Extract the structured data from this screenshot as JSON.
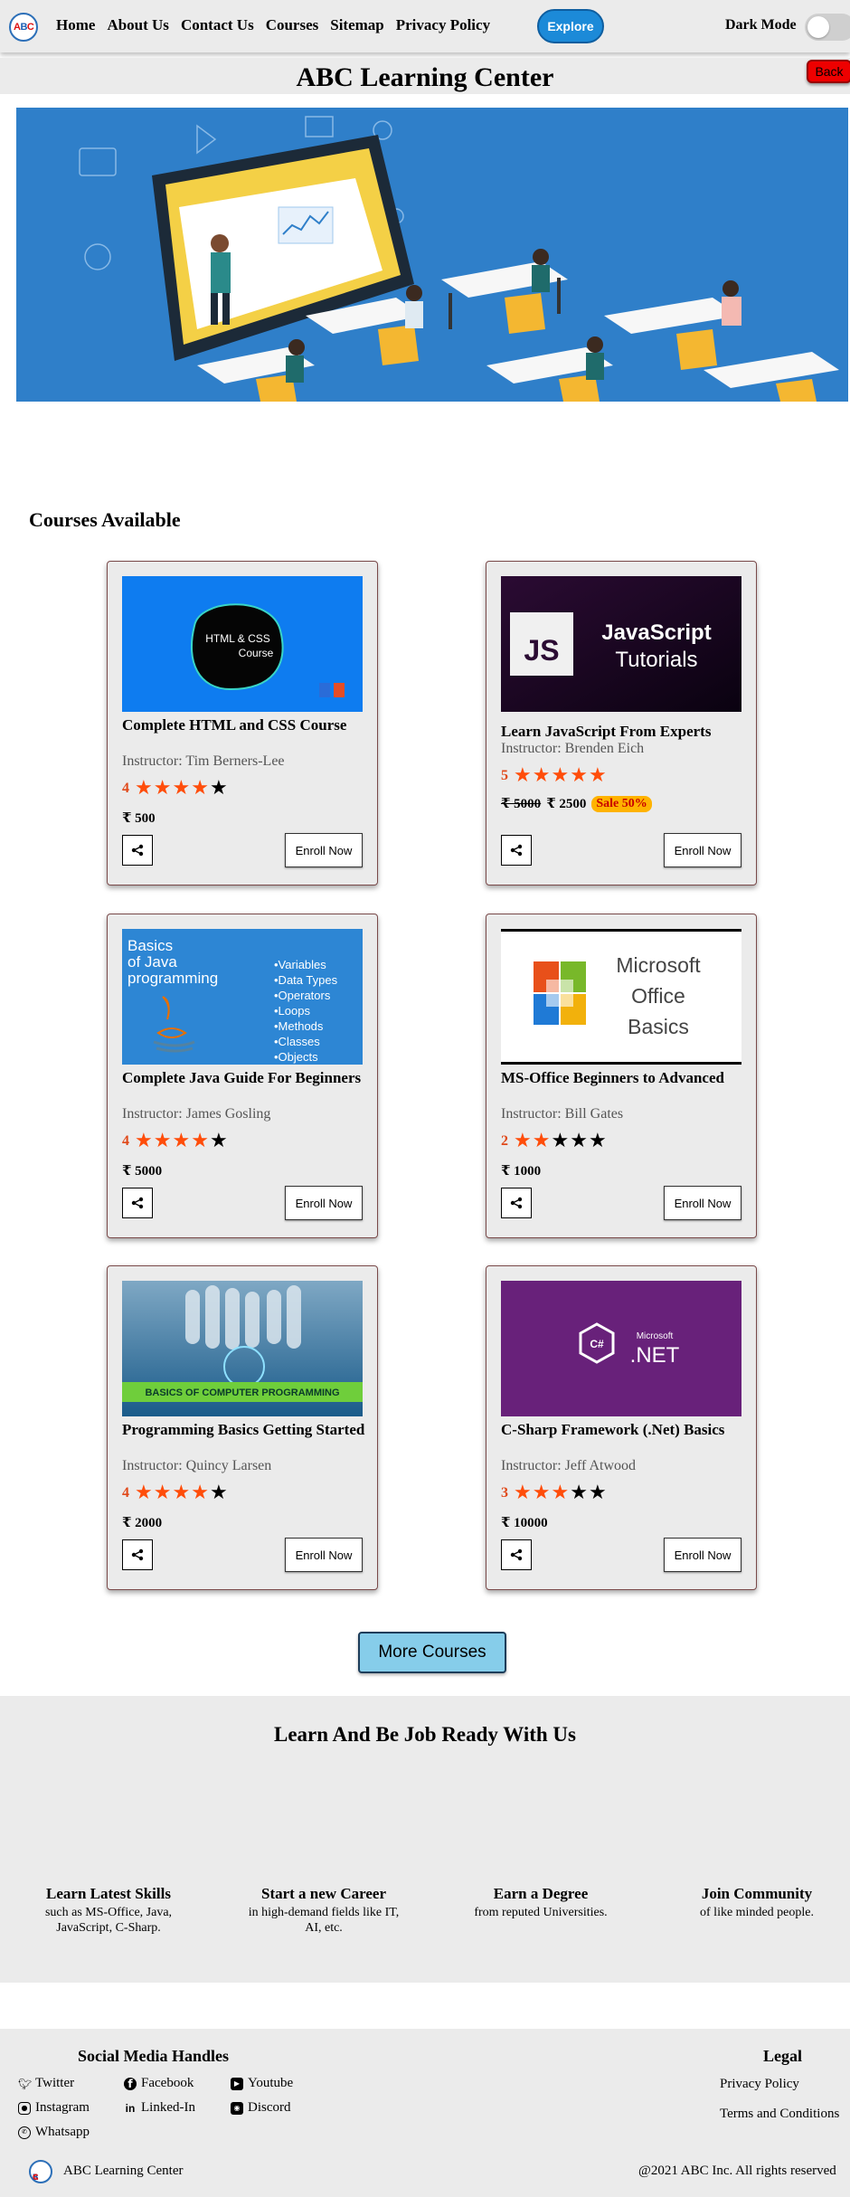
{
  "nav": {
    "logo_text": "ABC",
    "links": [
      "Home",
      "About Us",
      "Contact Us",
      "Courses",
      "Sitemap",
      "Privacy Policy"
    ],
    "explore_label": "Explore",
    "dark_mode_label": "Dark Mode"
  },
  "header": {
    "title": "ABC Learning Center",
    "back_label": "Back"
  },
  "courses_heading": "Courses Available",
  "courses": [
    {
      "title": "Complete HTML and CSS Course",
      "instructor": "Instructor: Tim Berners-Lee",
      "rating": "4",
      "stars_on": 4,
      "price": "₹ 500",
      "old_price": "",
      "sale": "",
      "enroll_label": "Enroll Now",
      "image_text": [
        "HTML & CSS",
        "Course"
      ]
    },
    {
      "title": "Learn JavaScript From Experts",
      "instructor": "Instructor: Brenden Eich",
      "rating": "5",
      "stars_on": 5,
      "price": "₹ 2500",
      "old_price": "₹ 5000",
      "sale": "Sale 50%",
      "enroll_label": "Enroll Now",
      "image_text": [
        "JS",
        "JavaScript",
        "Tutorials"
      ]
    },
    {
      "title": "Complete Java Guide For Beginners",
      "instructor": "Instructor: James Gosling",
      "rating": "4",
      "stars_on": 4,
      "price": "₹ 5000",
      "old_price": "",
      "sale": "",
      "enroll_label": "Enroll Now",
      "image_text": [
        "Basics",
        "of Java",
        "programming",
        "•Variables",
        "•Data Types",
        "•Operators",
        "•Loops",
        "•Methods",
        "•Classes",
        "•Objects"
      ]
    },
    {
      "title": "MS-Office Beginners to Advanced",
      "instructor": "Instructor: Bill Gates",
      "rating": "2",
      "stars_on": 2,
      "price": "₹ 1000",
      "old_price": "",
      "sale": "",
      "enroll_label": "Enroll Now",
      "image_text": [
        "Microsoft",
        "Office",
        "Basics"
      ]
    },
    {
      "title": "Programming Basics Getting Started",
      "instructor": "Instructor: Quincy Larsen",
      "rating": "4",
      "stars_on": 4,
      "price": "₹ 2000",
      "old_price": "",
      "sale": "",
      "enroll_label": "Enroll Now",
      "image_text": [
        "BASICS OF COMPUTER PROGRAMMING"
      ]
    },
    {
      "title": "C-Sharp Framework (.Net) Basics",
      "instructor": "Instructor: Jeff Atwood",
      "rating": "3",
      "stars_on": 3,
      "price": "₹ 10000",
      "old_price": "",
      "sale": "",
      "enroll_label": "Enroll Now",
      "image_text": [
        "Microsoft",
        ".NET"
      ]
    }
  ],
  "more_courses_label": "More Courses",
  "features": {
    "title": "Learn And Be Job Ready With Us",
    "items": [
      {
        "title": "Learn Latest Skills",
        "desc": "such as MS-Office, Java, JavaScript, C-Sharp."
      },
      {
        "title": "Start a new Career",
        "desc": "in high-demand fields like IT, AI, etc."
      },
      {
        "title": "Earn a Degree",
        "desc": "from reputed Universities."
      },
      {
        "title": "Join Community",
        "desc": "of like minded people."
      }
    ]
  },
  "footer": {
    "social_heading": "Social Media Handles",
    "social": [
      {
        "label": "Twitter",
        "icon": "twitter-icon"
      },
      {
        "label": "Facebook",
        "icon": "facebook-icon"
      },
      {
        "label": "Youtube",
        "icon": "youtube-icon"
      },
      {
        "label": "Instagram",
        "icon": "instagram-icon"
      },
      {
        "label": "Linked-In",
        "icon": "linkedin-icon"
      },
      {
        "label": "Discord",
        "icon": "discord-icon"
      },
      {
        "label": "Whatsapp",
        "icon": "whatsapp-icon"
      }
    ],
    "legal_heading": "Legal",
    "legal_links": [
      "Privacy Policy",
      "Terms and Conditions"
    ],
    "brand": "ABC Learning Center",
    "copyright": "@2021 ABC Inc. All rights reserved"
  },
  "colors": {
    "accent": "#1c8ad8",
    "star": "#ff4d0a",
    "back": "#ee0000",
    "more_button": "#86cdea",
    "panel": "#ebebeb"
  }
}
